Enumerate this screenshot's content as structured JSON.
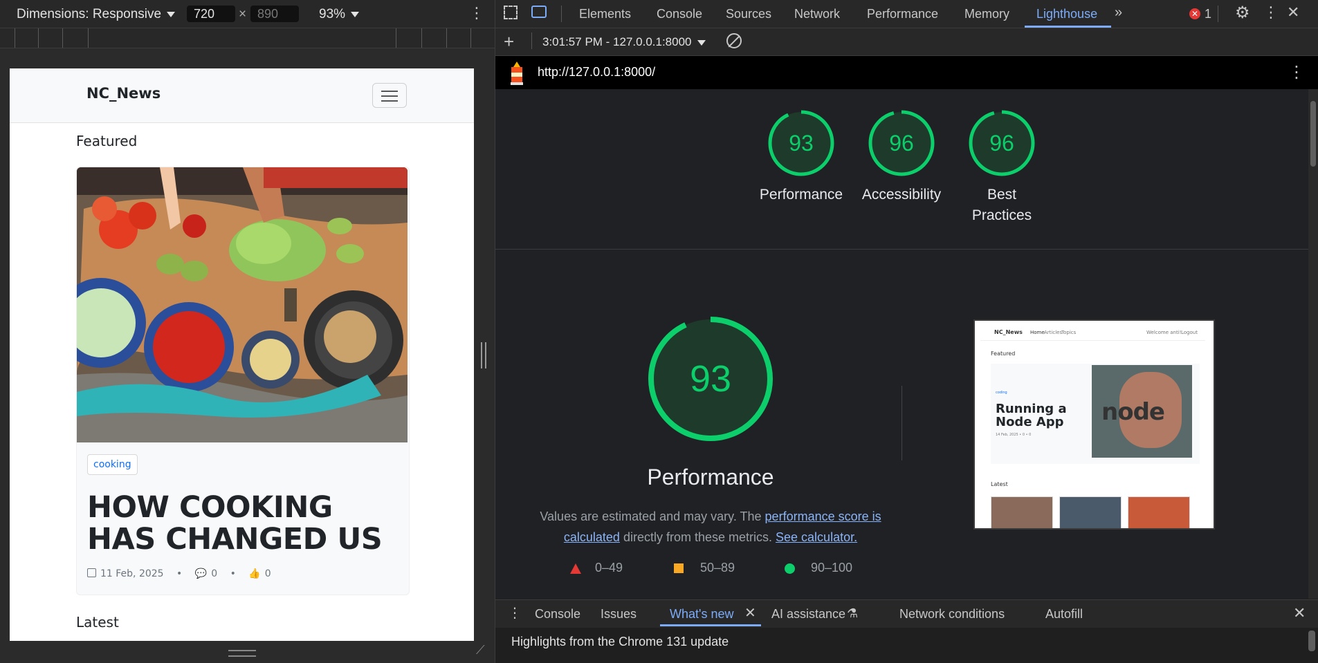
{
  "device_toolbar": {
    "dimensions_label": "Dimensions: Responsive",
    "width": "720",
    "height_placeholder": "890",
    "times": "×",
    "zoom": "93%"
  },
  "site": {
    "brand": "NC_News",
    "featured_heading": "Featured",
    "article": {
      "topic": "cooking",
      "title": "HOW COOKING HAS CHANGED US",
      "date": "11 Feb, 2025",
      "comments": "0",
      "votes": "0",
      "dot": "•"
    },
    "latest_heading": "Latest"
  },
  "devtools": {
    "tabs": [
      "Elements",
      "Console",
      "Sources",
      "Network",
      "Performance",
      "Memory",
      "Lighthouse"
    ],
    "active_tab": "Lighthouse",
    "error_count": "1",
    "report_selector": "3:01:57 PM - 127.0.0.1:8000",
    "url": "http://127.0.0.1:8000/"
  },
  "lighthouse": {
    "scores": [
      {
        "label": "Performance",
        "value": 93
      },
      {
        "label": "Accessibility",
        "value": 96
      },
      {
        "label": "Best Practices",
        "value": 96
      }
    ],
    "main": {
      "score": 93,
      "label": "Performance",
      "desc_prefix": "Values are estimated and may vary. The ",
      "link1": "performance score is calculated",
      "desc_mid": " directly from these metrics. ",
      "link2": "See calculator."
    },
    "legend": [
      {
        "range": "0–49",
        "color": "#e53935",
        "shape": "triangle"
      },
      {
        "range": "50–89",
        "color": "#f9a825",
        "shape": "square"
      },
      {
        "range": "90–100",
        "color": "#0cce6b",
        "shape": "circle"
      }
    ],
    "colors": {
      "pass": "#0cce6b",
      "pass_bg": "#1e3a2a"
    }
  },
  "screenshot_preview": {
    "brand": "NC_News",
    "nav": [
      "Home",
      "Articles",
      "Topics"
    ],
    "welcome": "Welcome anti!",
    "logout": "Logout",
    "featured": "Featured",
    "topic": "coding",
    "title": "Running a Node App",
    "meta": "14 Feb, 2025 • 0 • 0",
    "logo_text": "node",
    "latest": "Latest"
  },
  "drawer": {
    "tabs": [
      "Console",
      "Issues",
      "What's new",
      "AI assistance",
      "Network conditions",
      "Autofill"
    ],
    "active": "What's new",
    "content": "Highlights from the Chrome 131 update"
  }
}
